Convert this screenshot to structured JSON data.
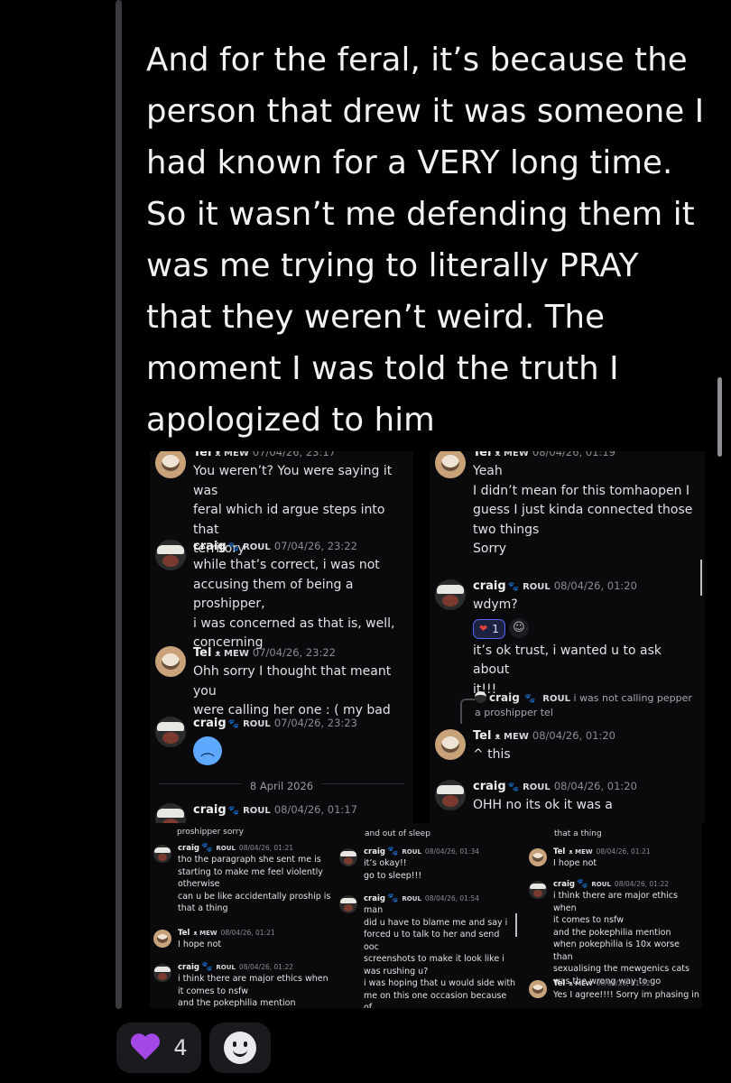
{
  "post": {
    "lines": [
      "And for the feral, it’s because the",
      "person that drew it was someone I",
      "had known for a VERY long time.",
      "So it wasn’t me defending them it",
      "was me trying to literally PRAY",
      "that they weren’t weird. The",
      "moment I  was told the truth I",
      "apologized to him"
    ]
  },
  "screenshot1": {
    "messages": [
      {
        "name": "Tel",
        "tag": "ᴥ MEW",
        "time": "07/04/26, 23:17",
        "text": "You weren’t? You were saying it was\nferal which id argue steps into that\nterritory"
      },
      {
        "name": "craig",
        "tag": "ROUL",
        "time": "07/04/26, 23:22",
        "text": "while that’s correct, i was not\naccusing them of being a proshipper,\ni was concerned as that is, well,\nconcerning"
      },
      {
        "name": "Tel",
        "tag": "ᴥ MEW",
        "time": "07/04/26, 23:22",
        "text": "Ohh sorry I thought that meant you\nwere calling her one : ( my bad"
      },
      {
        "name": "craig",
        "tag": "ROUL",
        "time": "07/04/26, 23:23",
        "text": ""
      },
      {
        "name": "craig",
        "tag": "ROUL",
        "time": "08/04/26, 01:17",
        "text": ""
      }
    ],
    "date_divider": "8 April 2026"
  },
  "screenshot2": {
    "messages": [
      {
        "name": "Tel",
        "tag": "ᴥ MEW",
        "time": "08/04/26, 01:19",
        "text": "Yeah\nI didn’t mean for this tomhaopen I\nguess I just kinda connected those\ntwo things\nSorry"
      },
      {
        "name": "craig",
        "tag": "ROUL",
        "time": "08/04/26, 01:20",
        "text": "wdym?"
      },
      {
        "name": "craig",
        "tag": "",
        "time": "",
        "text": "it’s ok trust, i wanted u to ask about\nit!!!"
      },
      {
        "name": "Tel",
        "tag": "ᴥ MEW",
        "time": "08/04/26, 01:20",
        "text": "^ this"
      },
      {
        "name": "craig",
        "tag": "ROUL",
        "time": "08/04/26, 01:20",
        "text": "OHH no its ok it was a"
      }
    ],
    "reaction_count": "1",
    "reply": {
      "name": "craig",
      "text": "i was not calling pepper a proshipper tel"
    }
  },
  "screenshot3": {
    "col1": {
      "cut_top": "proshipper sorry",
      "messages": [
        {
          "name": "craig",
          "tag": "ROUL",
          "time": "08/04/26, 01:21",
          "text": "tho the paragraph she sent me is\nstarting to make me feel violently\notherwise\ncan u be like accidentally proship is\nthat a thing"
        },
        {
          "name": "Tel",
          "tag": "ᴥ MEW",
          "time": "08/04/26, 01:21",
          "text": "I hope not"
        },
        {
          "name": "craig",
          "tag": "ROUL",
          "time": "08/04/26, 01:22",
          "text": "i think there are major ethics when\nit comes to nsfw\nand the pokephilia mention"
        }
      ]
    },
    "col2": {
      "cut_top": "and out of sleep",
      "messages": [
        {
          "name": "craig",
          "tag": "ROUL",
          "time": "08/04/26, 01:34",
          "text": "it’s okay!!\ngo to sleep!!!"
        },
        {
          "name": "craig",
          "tag": "ROUL",
          "time": "08/04/26, 01:54",
          "text": "man\ndid u have to blame me and say i\nforced u to talk to her and send ooc\nscreenshots to make it look like i\nwas rushing u?\ni was hoping that u would side with\nme on this one occasion because of\nhow bad this looks"
        }
      ]
    },
    "col3": {
      "cut_top": "that a thing",
      "messages": [
        {
          "name": "Tel",
          "tag": "ᴥ MEW",
          "time": "08/04/26, 01:21",
          "text": "I hope not"
        },
        {
          "name": "craig",
          "tag": "ROUL",
          "time": "08/04/26, 01:22",
          "text": "i think there are major ethics when\nit comes to nsfw\nand the pokephilia mention\nwhen pokephilia is 10x worse than\nsexualising the mewgenics cats\nwas the wrong way to go"
        },
        {
          "name": "Tel",
          "tag": "ᴥ MEW",
          "time": "08/04/26, 01:32",
          "text": "Yes I agree!!!! Sorry im phasing in"
        }
      ]
    }
  },
  "reactions": {
    "purple_heart_count": "4"
  },
  "colors": {
    "accent": "#5865f2",
    "heart": "#a347e6",
    "background": "#000000"
  }
}
